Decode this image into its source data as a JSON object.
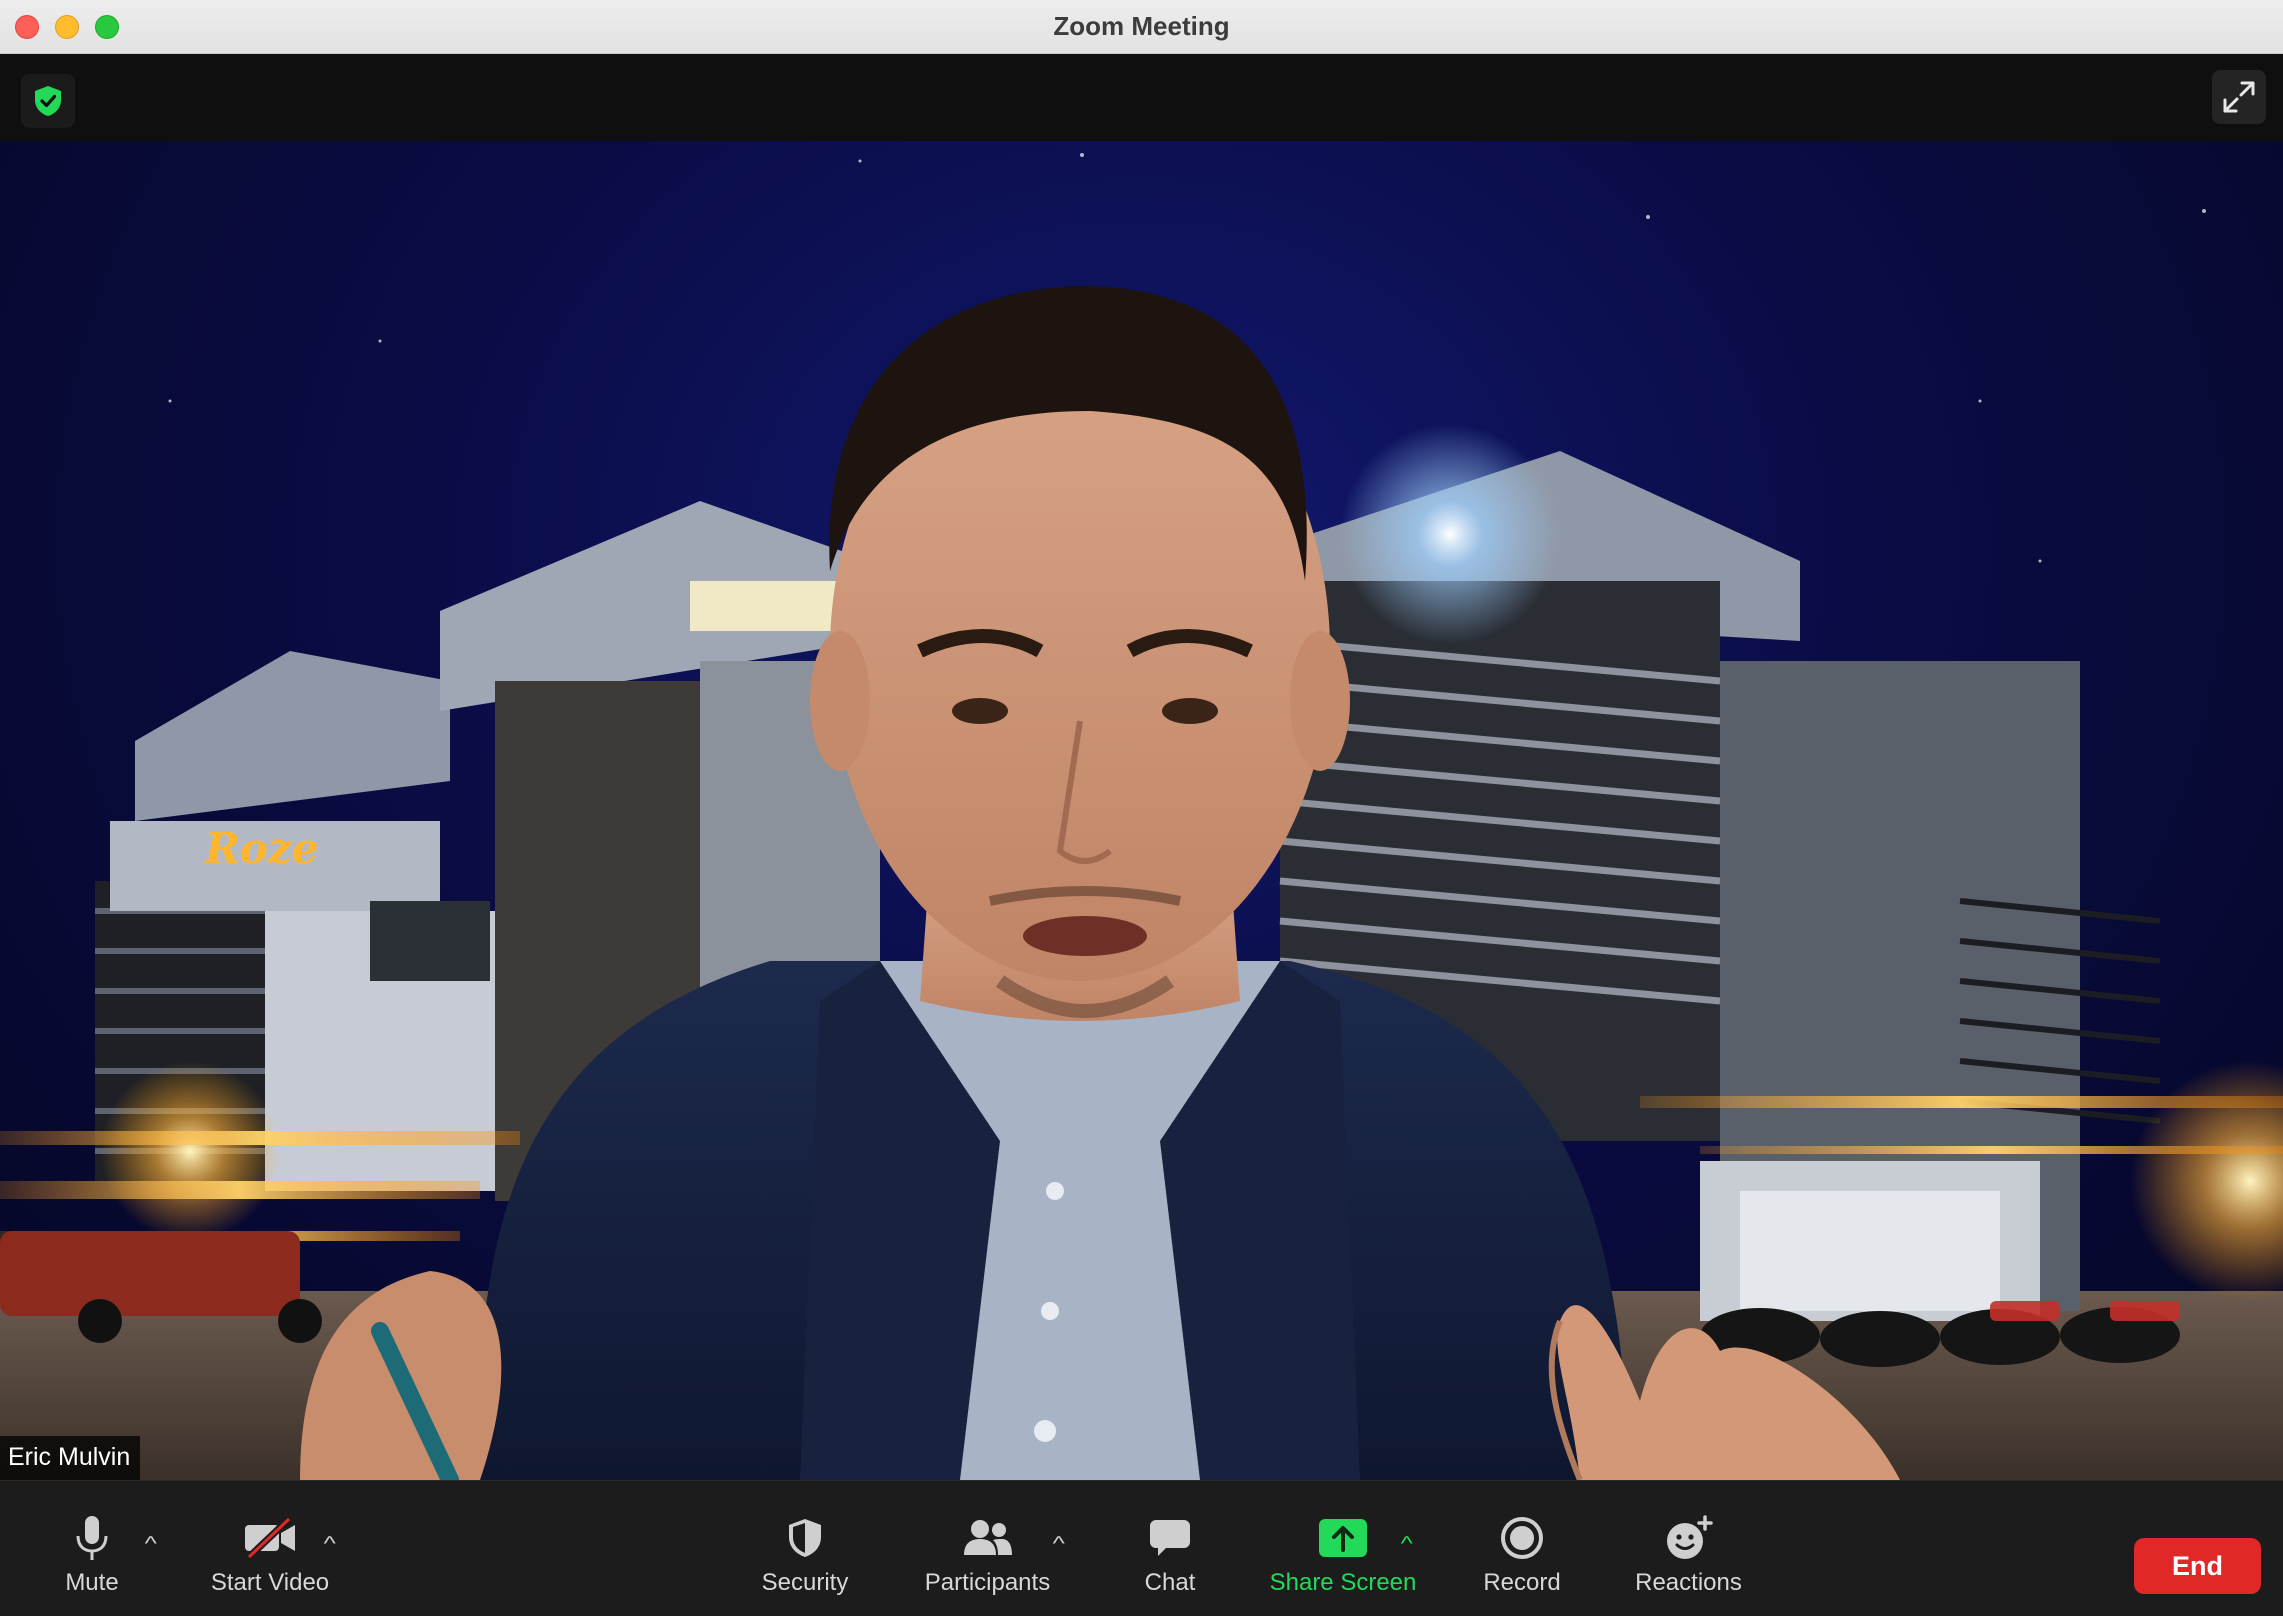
{
  "window": {
    "title": "Zoom Meeting"
  },
  "top_bar": {
    "security_indicator_icon": "shield-check-icon",
    "fullscreen_icon": "expand-icon"
  },
  "video": {
    "participant_name": "Eric Mulvin",
    "background_sign": "Roze"
  },
  "toolbar": {
    "mute": {
      "label": "Mute",
      "icon": "microphone-icon"
    },
    "start_video": {
      "label": "Start Video",
      "icon": "video-off-icon"
    },
    "security": {
      "label": "Security",
      "icon": "shield-icon"
    },
    "participants": {
      "label": "Participants",
      "icon": "people-icon"
    },
    "chat": {
      "label": "Chat",
      "icon": "chat-bubble-icon"
    },
    "share_screen": {
      "label": "Share Screen",
      "icon": "share-arrow-icon"
    },
    "record": {
      "label": "Record",
      "icon": "record-icon"
    },
    "reactions": {
      "label": "Reactions",
      "icon": "smiley-plus-icon"
    },
    "end": {
      "label": "End"
    }
  },
  "colors": {
    "accent_green": "#23d959",
    "end_red": "#e02828",
    "toolbar_bg": "#1c1c1c"
  }
}
